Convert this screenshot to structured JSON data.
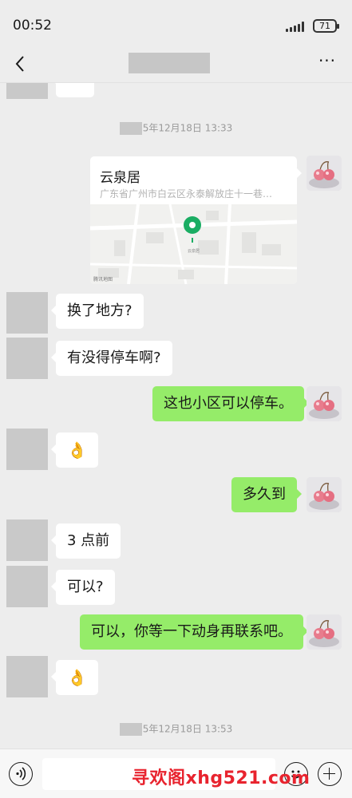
{
  "status_bar": {
    "time": "00:52",
    "battery": "71"
  },
  "nav": {
    "back_icon": "chevron-left-icon",
    "more_icon": "more-dots-icon",
    "more_label": "···"
  },
  "timestamps": [
    {
      "text": "5年12月18日 13:33"
    },
    {
      "text": "5年12月18日 13:53"
    }
  ],
  "location": {
    "name": "云泉居",
    "address": "广东省广州市白云区永泰解放庄十一巷…",
    "map_pin_color": "#1aad63",
    "map_labels": [
      "云泉居",
      "腾讯地图"
    ]
  },
  "messages": [
    {
      "side": "in",
      "text": "换了地方?"
    },
    {
      "side": "in",
      "text": "有没得停车啊?"
    },
    {
      "side": "out",
      "text": "这也小区可以停车。"
    },
    {
      "side": "in",
      "text": "👌"
    },
    {
      "side": "out",
      "text": "多久到"
    },
    {
      "side": "in",
      "text": "3 点前"
    },
    {
      "side": "in",
      "text": "可以?"
    },
    {
      "side": "out",
      "text": "可以，你等一下动身再联系吧。"
    },
    {
      "side": "in",
      "text": "👌"
    }
  ],
  "input_bar": {
    "voice_icon": "voice-icon",
    "emoji_icon": "emoji-icon",
    "plus_icon": "plus-icon",
    "watermark": "寻欢阁xhg521.com"
  },
  "colors": {
    "outgoing_bubble": "#95ec69",
    "incoming_bubble": "#ffffff",
    "background": "#ededed"
  }
}
